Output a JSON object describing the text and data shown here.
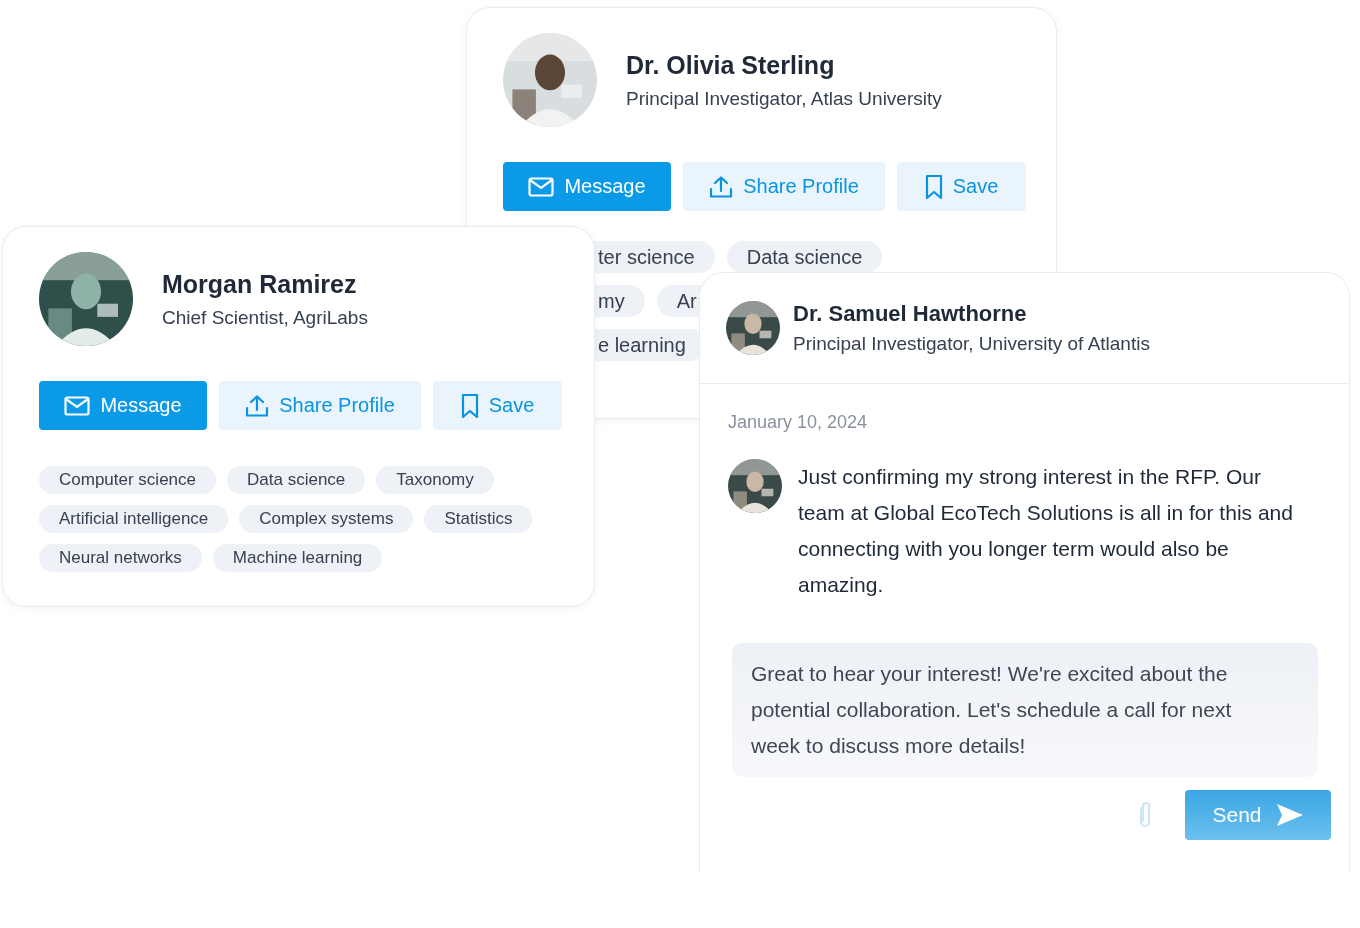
{
  "profile_cards": [
    {
      "name": "Dr. Olivia Sterling",
      "title": "Principal Investigator, Atlas University",
      "buttons": [
        {
          "kind": "message",
          "label": "Message"
        },
        {
          "kind": "share",
          "label": "Share Profile"
        },
        {
          "kind": "save",
          "label": "Save"
        }
      ],
      "tag_rows": [
        [
          "ter science",
          "Data science"
        ],
        [
          "my",
          "Ar"
        ],
        [
          "e learning"
        ]
      ]
    },
    {
      "name": "Morgan Ramirez",
      "title": "Chief Scientist, AgriLabs",
      "buttons": [
        {
          "kind": "message",
          "label": "Message"
        },
        {
          "kind": "share",
          "label": "Share Profile"
        },
        {
          "kind": "save",
          "label": "Save"
        }
      ],
      "tag_rows": [
        [
          "Computer science",
          "Data science",
          "Taxonomy"
        ],
        [
          "Artificial intelligence",
          "Complex systems",
          "Statistics"
        ],
        [
          "Neural networks",
          "Machine learning"
        ]
      ]
    }
  ],
  "chat": {
    "contact": {
      "name": "Dr. Samuel Hawthorne",
      "title": "Principal Investigator, University of Atlantis"
    },
    "date": "January 10, 2024",
    "messages": [
      {
        "kind": "incoming",
        "text": "Just confirming my strong interest in the RFP. Our team at Global EcoTech Solutions is all in for this and connecting with you longer term would also be amazing."
      }
    ],
    "reply_field": {
      "value": "Great to hear your interest! We're excited about the potential collaboration. Let's schedule a call for next week to discuss more details!"
    },
    "send_button": {
      "label": "Send"
    }
  }
}
